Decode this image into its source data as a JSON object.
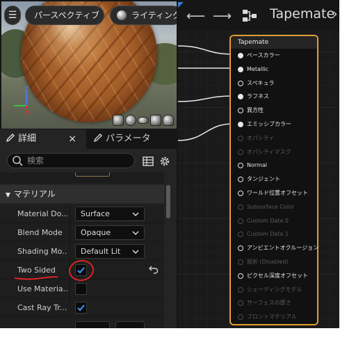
{
  "viewport": {
    "menu_icon": "menu-icon",
    "perspective_label": "パースペクティブ",
    "lighting_label": "ライティング"
  },
  "details": {
    "tab_details": "詳細",
    "tab_close": "×",
    "tab_params": "パラメータ",
    "search_placeholder": "検索",
    "section_title": "マテリアル",
    "rows": [
      {
        "label": "Material Do...",
        "type": "dropdown",
        "value": "Surface"
      },
      {
        "label": "Blend Mode",
        "type": "dropdown",
        "value": "Opaque"
      },
      {
        "label": "Shading Mo...",
        "type": "dropdown",
        "value": "Default Lit"
      },
      {
        "label": "Two Sided",
        "type": "checkbox",
        "checked": true
      },
      {
        "label": "Use Materia...",
        "type": "checkbox",
        "checked": false
      },
      {
        "label": "Cast Ray Tr...",
        "type": "checkbox",
        "checked": true
      }
    ],
    "annotation_color": "#e02323"
  },
  "graph": {
    "title": "Tapemate",
    "chevron": "›",
    "back_icon": "arrow-left-icon",
    "forward_icon": "arrow-right-icon"
  },
  "node": {
    "title": "Tapemate",
    "border_color": "#e0a030",
    "pins": [
      {
        "label": "ベースカラー",
        "enabled": true,
        "connected": true
      },
      {
        "label": "Metallic",
        "enabled": true,
        "connected": true
      },
      {
        "label": "スペキュラ",
        "enabled": true,
        "connected": false
      },
      {
        "label": "ラフネス",
        "enabled": true,
        "connected": true
      },
      {
        "label": "異方性",
        "enabled": true,
        "connected": false
      },
      {
        "label": "エミッシブカラー",
        "enabled": true,
        "connected": true
      },
      {
        "label": "オパシティ",
        "enabled": false,
        "connected": false
      },
      {
        "label": "オパシティマスク",
        "enabled": false,
        "connected": false
      },
      {
        "label": "Normal",
        "enabled": true,
        "connected": false
      },
      {
        "label": "タンジェント",
        "enabled": true,
        "connected": false
      },
      {
        "label": "ワールド位置オフセット",
        "enabled": true,
        "connected": false
      },
      {
        "label": "Subsurface Color",
        "enabled": false,
        "connected": false
      },
      {
        "label": "Custom Data 0",
        "enabled": false,
        "connected": false
      },
      {
        "label": "Custom Data 1",
        "enabled": false,
        "connected": false
      },
      {
        "label": "アンビエントオクルージョン",
        "enabled": true,
        "connected": false
      },
      {
        "label": "屈折 (Disabled)",
        "enabled": false,
        "connected": false
      },
      {
        "label": "ピクセル深度オフセット",
        "enabled": true,
        "connected": false
      },
      {
        "label": "シェーディングモデル",
        "enabled": false,
        "connected": false
      },
      {
        "label": "サーフェスの厚さ",
        "enabled": false,
        "connected": false
      },
      {
        "label": "フロントマテリアル",
        "enabled": false,
        "connected": false
      }
    ]
  }
}
